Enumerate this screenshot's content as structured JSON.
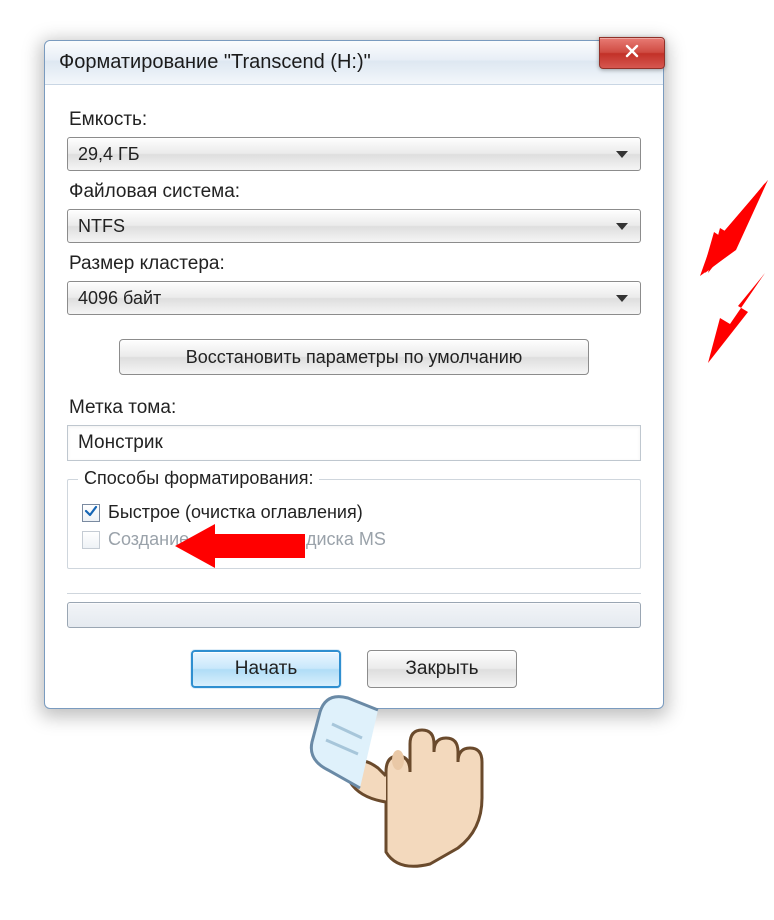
{
  "title": "Форматирование \"Transcend (H:)\"",
  "capacity": {
    "label": "Емкость:",
    "value": "29,4 ГБ"
  },
  "filesystem": {
    "label": "Файловая система:",
    "value": "NTFS"
  },
  "cluster": {
    "label": "Размер кластера:",
    "value": "4096 байт"
  },
  "restore_btn": "Восстановить параметры по умолчанию",
  "volume": {
    "label": "Метка тома:",
    "value": "Монстрик"
  },
  "group": {
    "title": "Способы форматирования:",
    "quick": "Быстрое (очистка оглавления)",
    "bootable": "Создание загрузочного диска MS"
  },
  "start_btn": "Начать",
  "close_btn": "Закрыть"
}
